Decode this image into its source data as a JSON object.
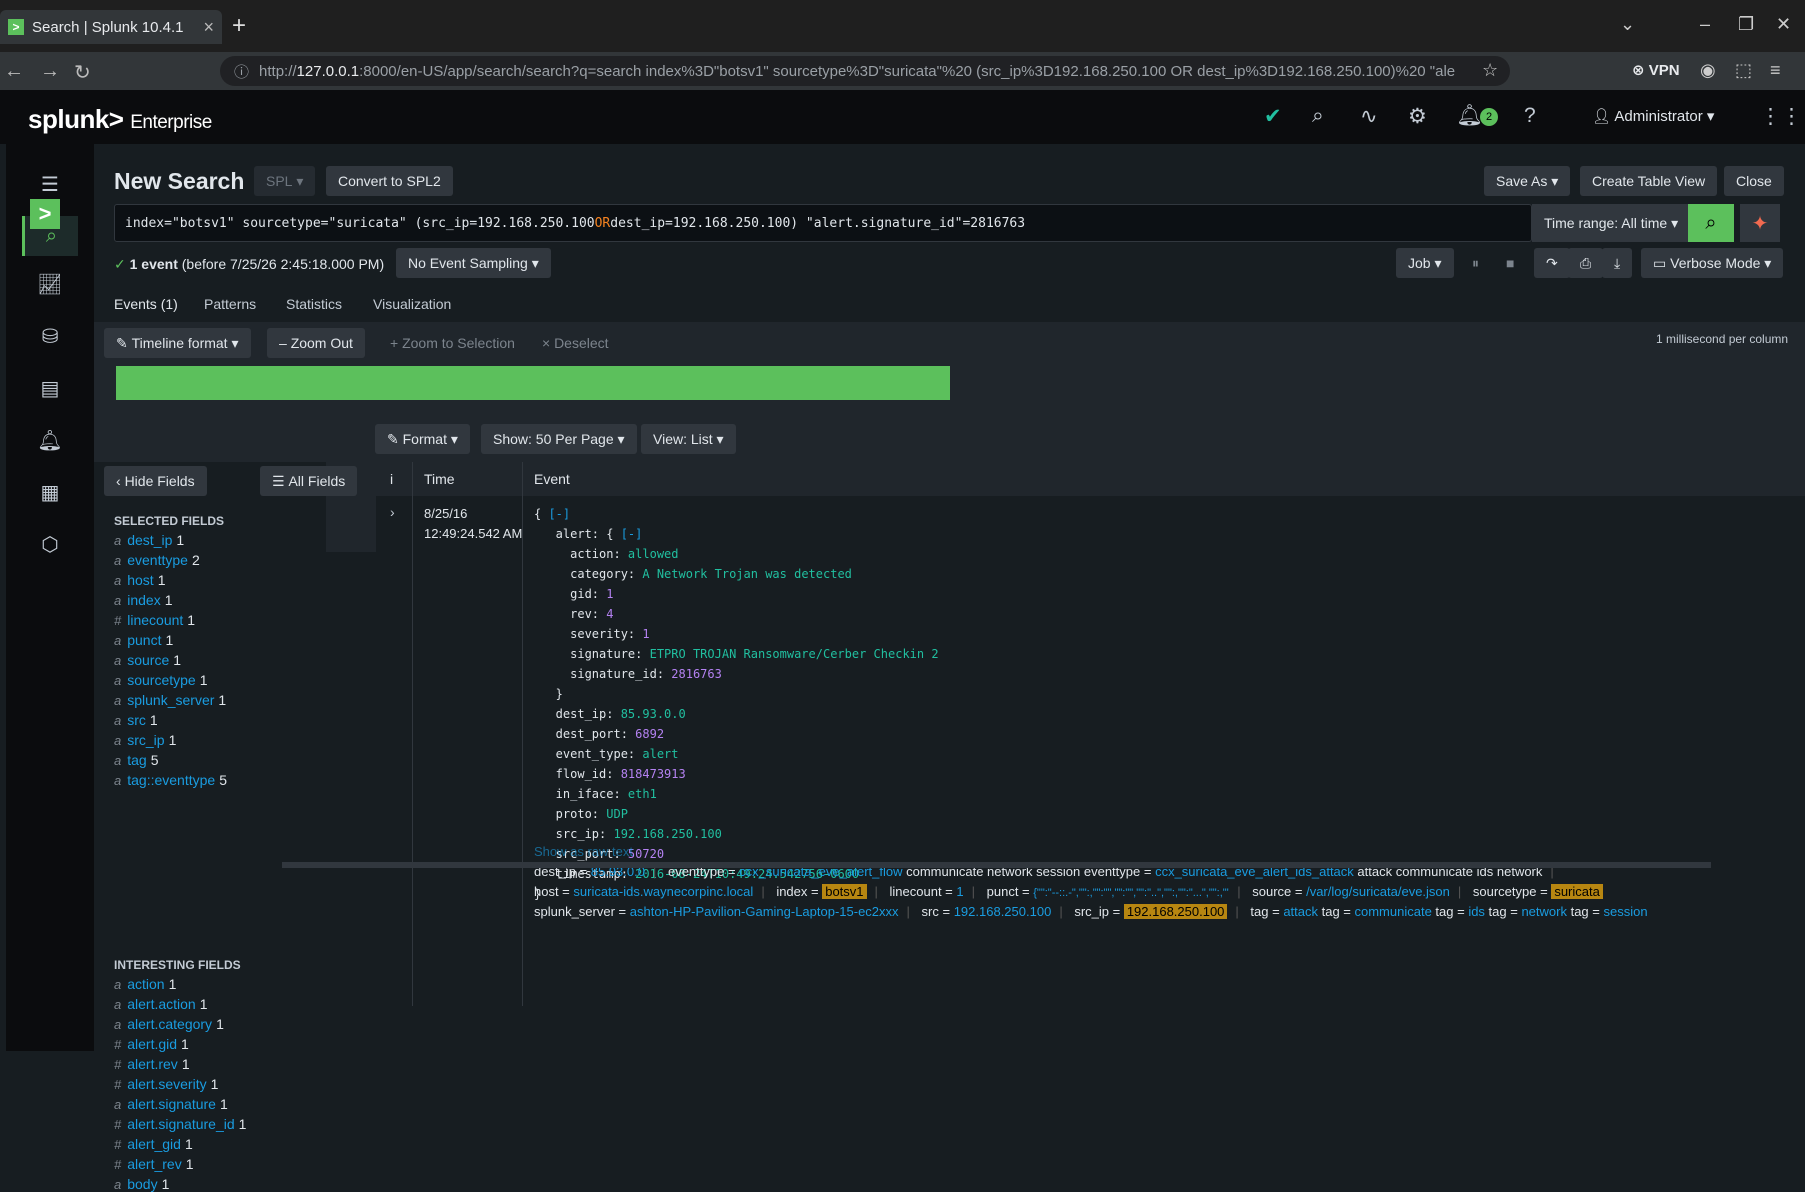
{
  "browser": {
    "tab_title": "Search | Splunk 10.4.1",
    "favicon": ">",
    "url_prefix": "http://",
    "url_host": "127.0.0.1",
    "url_rest": ":8000/en-US/app/search/search?q=search index%3D\"botsv1\" sourcetype%3D\"suricata\"%20 (src_ip%3D192.168.250.100 OR dest_ip%3D192.168.250.100)%20 \"ale",
    "vpn": "VPN"
  },
  "header": {
    "logo": "splunk>",
    "product": "Enterprise",
    "notif_count": "2",
    "user": "Administrator"
  },
  "search": {
    "title": "New Search",
    "lang": "SPL",
    "convert": "Convert to SPL2",
    "save_as": "Save As",
    "create_table": "Create Table View",
    "close": "Close",
    "query_a": "index=\"botsv1\" sourcetype=\"suricata\"  (src_ip=192.168.250.100 ",
    "query_or": "OR",
    "query_b": " dest_ip=192.168.250.100)  \"alert.signature_id\"=2816763",
    "time_range": "Time range: All time",
    "status_count": "1 event",
    "status_rest": " (before 7/25/26 2:45:18.000 PM)",
    "sampling": "No Event Sampling",
    "job": "Job",
    "mode": "Verbose Mode"
  },
  "tabs": [
    "Events (1)",
    "Patterns",
    "Statistics",
    "Visualization"
  ],
  "timeline": {
    "format": "Timeline format",
    "zoom_out": "Zoom Out",
    "zoom_sel": "+ Zoom to Selection",
    "deselect": "× Deselect",
    "scale": "1 millisecond per column"
  },
  "results": {
    "format": "Format",
    "per_page": "Show: 50 Per Page",
    "view": "View: List",
    "col_i": "i",
    "col_time": "Time",
    "col_event": "Event",
    "date": "8/25/16",
    "time": "12:49:24.542 AM",
    "show_raw": "Show as raw text"
  },
  "fields": {
    "hide": "Hide Fields",
    "all": "All Fields",
    "selected_title": "SELECTED FIELDS",
    "interesting_title": "INTERESTING FIELDS",
    "selected": [
      {
        "t": "a",
        "n": "dest_ip",
        "c": "1"
      },
      {
        "t": "a",
        "n": "eventtype",
        "c": "2"
      },
      {
        "t": "a",
        "n": "host",
        "c": "1"
      },
      {
        "t": "a",
        "n": "index",
        "c": "1"
      },
      {
        "t": "#",
        "n": "linecount",
        "c": "1"
      },
      {
        "t": "a",
        "n": "punct",
        "c": "1"
      },
      {
        "t": "a",
        "n": "source",
        "c": "1"
      },
      {
        "t": "a",
        "n": "sourcetype",
        "c": "1"
      },
      {
        "t": "a",
        "n": "splunk_server",
        "c": "1"
      },
      {
        "t": "a",
        "n": "src",
        "c": "1"
      },
      {
        "t": "a",
        "n": "src_ip",
        "c": "1"
      },
      {
        "t": "a",
        "n": "tag",
        "c": "5"
      },
      {
        "t": "a",
        "n": "tag::eventtype",
        "c": "5"
      }
    ],
    "interesting": [
      {
        "t": "a",
        "n": "action",
        "c": "1"
      },
      {
        "t": "a",
        "n": "alert.action",
        "c": "1"
      },
      {
        "t": "a",
        "n": "alert.category",
        "c": "1"
      },
      {
        "t": "#",
        "n": "alert.gid",
        "c": "1"
      },
      {
        "t": "#",
        "n": "alert.rev",
        "c": "1"
      },
      {
        "t": "#",
        "n": "alert.severity",
        "c": "1"
      },
      {
        "t": "a",
        "n": "alert.signature",
        "c": "1"
      },
      {
        "t": "#",
        "n": "alert.signature_id",
        "c": "1"
      },
      {
        "t": "#",
        "n": "alert_gid",
        "c": "1"
      },
      {
        "t": "#",
        "n": "alert_rev",
        "c": "1"
      },
      {
        "t": "a",
        "n": "body",
        "c": "1"
      }
    ]
  },
  "event_json": {
    "action": "allowed",
    "category": "A Network Trojan was detected",
    "gid": "1",
    "rev": "4",
    "severity": "1",
    "signature": "ETPRO TROJAN Ransomware/Cerber Checkin 2",
    "signature_id": "2816763",
    "dest_ip": "85.93.0.0",
    "dest_port": "6892",
    "event_type": "alert",
    "flow_id": "818473913",
    "in_iface": "eth1",
    "proto": "UDP",
    "src_ip": "192.168.250.100",
    "src_port": "50720",
    "timestamp": "2016-08-24T10:49:24.542756-0600"
  },
  "event_fields": {
    "dest_ip": "85.93.0.0",
    "eventtype1": "ccx_suricata_eve_alert_flow",
    "eventtype1_tags": "communicate network session",
    "eventtype2": "ccx_suricata_eve_alert_ids_attack",
    "eventtype2_tags": "attack communicate ids network",
    "host": "suricata-ids.waynecorpinc.local",
    "index": "botsv1",
    "linecount": "1",
    "punct": "{\"\":\"--::.-\",\"\":,\"\":\"\",\"\":\"\",\"\":\"..\",\"\":,\"\":\"...\",\"\":,\"\":\"\",\"\":{\"\":\"\",\"\":,\"\":,\"\":,\"\":\"",
    "source": "/var/log/suricata/eve.json",
    "sourcetype": "suricata",
    "splunk_server": "ashton-HP-Pavilion-Gaming-Laptop-15-ec2xxx",
    "src": "192.168.250.100",
    "src_ip": "192.168.250.100",
    "tags": [
      "attack",
      "communicate",
      "ids",
      "network",
      "session"
    ]
  }
}
